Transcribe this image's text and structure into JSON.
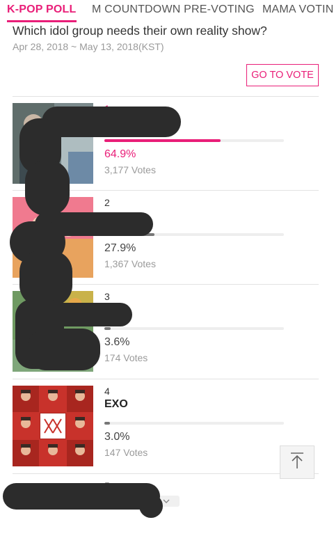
{
  "tabs": [
    {
      "label": "K-POP POLL",
      "active": true
    },
    {
      "label": "M COUNTDOWN PRE-VOTING",
      "active": false
    },
    {
      "label": "MAMA VOTING",
      "active": false
    }
  ],
  "poll": {
    "question": "Which idol group needs their own reality show?",
    "dates": "Apr 28, 2018 ~ May 13, 2018(KST)",
    "vote_button": "GO TO VOTE"
  },
  "results": [
    {
      "rank": "1",
      "name": "",
      "percent": "64.9%",
      "votes": "3,177 Votes",
      "fraction": 0.649
    },
    {
      "rank": "2",
      "name": "",
      "percent": "27.9%",
      "votes": "1,367 Votes",
      "fraction": 0.279
    },
    {
      "rank": "3",
      "name": "",
      "percent": "3.6%",
      "votes": "174 Votes",
      "fraction": 0.036
    },
    {
      "rank": "4",
      "name": "EXO",
      "percent": "3.0%",
      "votes": "147 Votes",
      "fraction": 0.03
    },
    {
      "rank": "5",
      "name": "",
      "percent": "",
      "votes": "",
      "fraction": null
    }
  ],
  "colors": {
    "accent": "#e91e78",
    "bar_secondary": "#777777",
    "redaction": "#2c2c2c"
  },
  "icons": {
    "scroll_top": "arrow-up-icon",
    "expand": "chevron-down-icon"
  }
}
